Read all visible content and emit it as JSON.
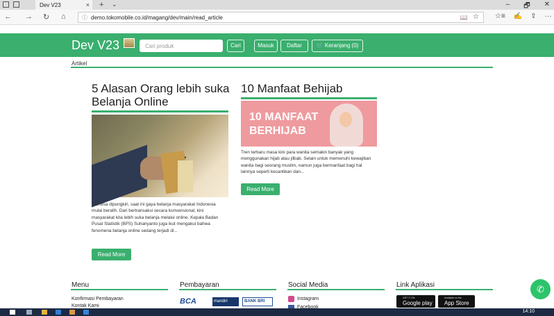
{
  "browser": {
    "tab_title": "Dev V23",
    "tab_close": "×",
    "new_tab": "+",
    "tabs_dropdown": "⌄",
    "window_controls": [
      "–",
      "🗗",
      "✕"
    ],
    "nav": {
      "back": "←",
      "forward": "→",
      "refresh": "↻",
      "home": "⌂"
    },
    "url": "demo.tokomobile.co.id/magang/dev/main/read_article",
    "info_icon": "ⓘ",
    "reading_icon": "📖",
    "favorite_icon": "☆",
    "right_controls": [
      "☆≡",
      "✍",
      "⇪",
      "···"
    ]
  },
  "header": {
    "brand": "Dev V23",
    "search_placeholder": "Cari produk",
    "search_button": "Cari",
    "login_button": "Masuk",
    "register_button": "Daftar",
    "cart_button": "🛒 Keranjang (0)"
  },
  "breadcrumb": "Artikel",
  "articles": [
    {
      "title": "5 Alasan Orang lebih suka Belanja Online",
      "excerpt": "Tak bisa dipungkiri, saat ini gaya belanja masyarakat Indonesia mulai beralih. Dari bertransaksi secara konvensional, kini masyarakat kita lebih suka belanja melalui online. Kepala Badan Pusat Statistik (BPS) Suhariyanto juga ikut mengakui bahwa fenomena belanja online sedang terjadi di...",
      "read_more": "Read More"
    },
    {
      "title": "10 Manfaat Behijab",
      "image_text_1": "10 MANFAAT",
      "image_text_2": "BERHIJAB",
      "excerpt": "Tren terbaru masa kini para wanita semakin banyak yang menggunakan hijab atau jilbab. Selain untuk memenuhi kewajiban wanita bagi seorang muslim, namun juga bermanfaat bagi hal lainnya seperti kecantikan dan...",
      "read_more": "Read More"
    }
  ],
  "footer": {
    "menu_title": "Menu",
    "menu_items": [
      "Konfirmasi Pembayaran",
      "Kontak Kami"
    ],
    "payment_title": "Pembayaran",
    "payment_logos": [
      "BCA",
      "mandiri",
      "BANK BRI"
    ],
    "social_title": "Social Media",
    "social_items": [
      "Instagram",
      "Facebook"
    ],
    "apps_title": "Link Aplikasi",
    "google_play_small": "GET IT ON",
    "google_play": "Google play",
    "app_store_small": "Available on the",
    "app_store": "App Store"
  },
  "whatsapp_icon": "✆",
  "taskbar": {
    "time": "14:10"
  }
}
